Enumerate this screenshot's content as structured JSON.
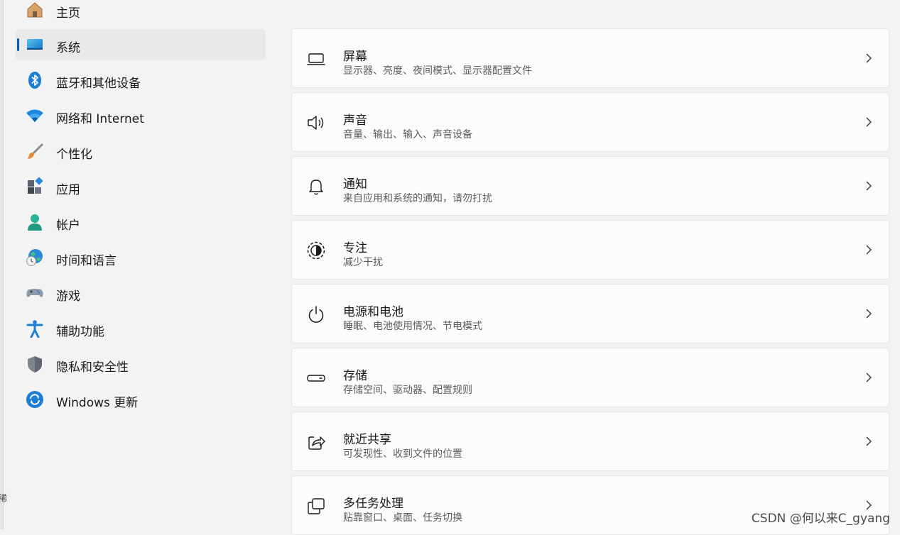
{
  "sidebar": {
    "items": [
      {
        "label": "主页",
        "icon": "home-icon"
      },
      {
        "label": "系统",
        "icon": "system-icon",
        "selected": true
      },
      {
        "label": "蓝牙和其他设备",
        "icon": "bluetooth-icon"
      },
      {
        "label": "网络和 Internet",
        "icon": "wifi-icon"
      },
      {
        "label": "个性化",
        "icon": "brush-icon"
      },
      {
        "label": "应用",
        "icon": "apps-icon"
      },
      {
        "label": "帐户",
        "icon": "account-icon"
      },
      {
        "label": "时间和语言",
        "icon": "time-language-icon"
      },
      {
        "label": "游戏",
        "icon": "gaming-icon"
      },
      {
        "label": "辅助功能",
        "icon": "accessibility-icon"
      },
      {
        "label": "隐私和安全性",
        "icon": "shield-icon"
      },
      {
        "label": "Windows 更新",
        "icon": "update-icon"
      }
    ]
  },
  "main": {
    "cards": [
      {
        "title": "屏幕",
        "subtitle": "显示器、亮度、夜间模式、显示器配置文件",
        "icon": "display-icon"
      },
      {
        "title": "声音",
        "subtitle": "音量、输出、输入、声音设备",
        "icon": "speaker-icon"
      },
      {
        "title": "通知",
        "subtitle": "来自应用和系统的通知，请勿打扰",
        "icon": "bell-icon"
      },
      {
        "title": "专注",
        "subtitle": "减少干扰",
        "icon": "focus-icon"
      },
      {
        "title": "电源和电池",
        "subtitle": "睡眠、电池使用情况、节电模式",
        "icon": "power-icon"
      },
      {
        "title": "存储",
        "subtitle": "存储空间、驱动器、配置规则",
        "icon": "storage-icon"
      },
      {
        "title": "就近共享",
        "subtitle": "可发现性、收到文件的位置",
        "icon": "share-icon"
      },
      {
        "title": "多任务处理",
        "subtitle": "贴靠窗口、桌面、任务切换",
        "icon": "multitask-icon"
      }
    ]
  },
  "watermark": "CSDN @何以来C_gyang",
  "edge_glyph": "稀",
  "colors": {
    "accent": "#005fb8",
    "window_bg": "#f3f3f3",
    "card_bg": "#fbfbfb",
    "selected_bg": "#e9e9e9"
  }
}
